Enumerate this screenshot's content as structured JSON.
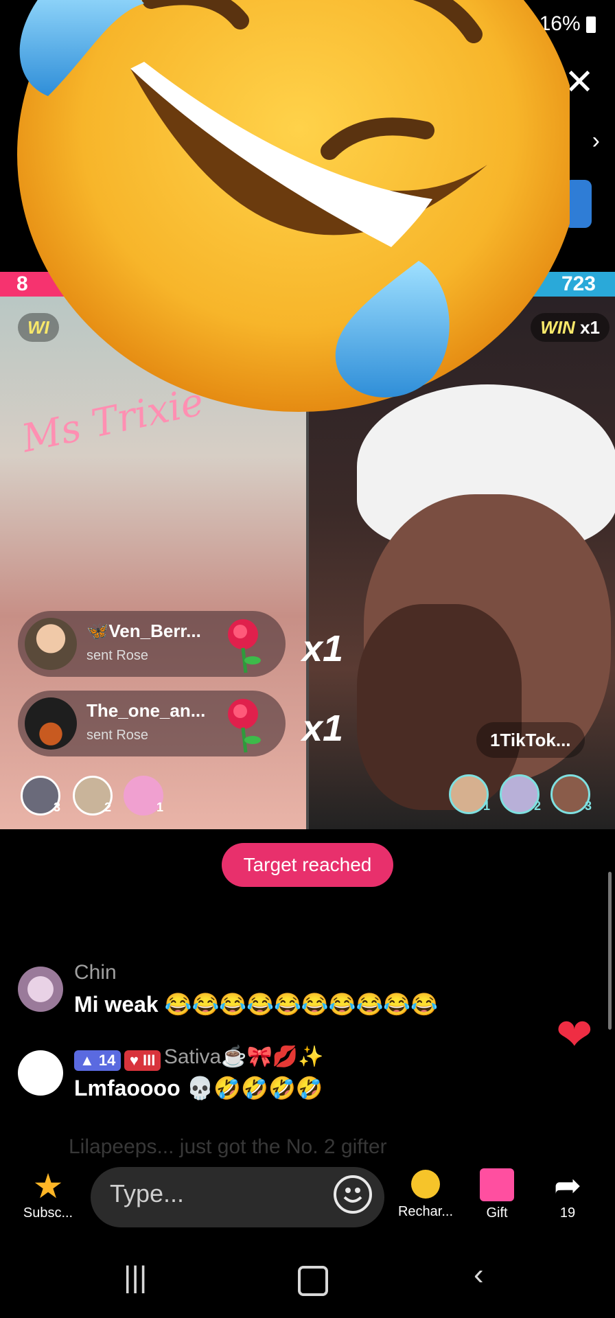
{
  "status": {
    "battery": "16%"
  },
  "battle": {
    "score_left": "8",
    "score_right": "723",
    "win_left": "WI",
    "win_right_word": "WIN",
    "win_right_mult": "x1"
  },
  "left_pane": {
    "neon_sign": "Ms Trixie"
  },
  "gifts": [
    {
      "user": "🦋Ven_Berr...",
      "action": "sent Rose",
      "count": "x1"
    },
    {
      "user": "The_one_an...",
      "action": "sent Rose",
      "count": "x1"
    }
  ],
  "right_pane": {
    "host_tag": "1TikTok..."
  },
  "rank_left": [
    "3",
    "2",
    "1"
  ],
  "rank_right": [
    "1",
    "2",
    "3"
  ],
  "target_label": "Target reached",
  "chat": [
    {
      "name": "Chin",
      "message": "Mi weak 😂😂😂😂😂😂😂😂😂😂"
    },
    {
      "name": "Sativa☕🎀💋✨",
      "badge_level": "14",
      "badge_fan": "III",
      "message": "Lmfaoooo 💀🤣🤣🤣🤣"
    }
  ],
  "chat_faded": "Lilapeeps... just got the No. 2 gifter",
  "input": {
    "placeholder": "Type..."
  },
  "bottom": {
    "subscribe": "Subsc...",
    "recharge": "Rechar...",
    "gift": "Gift",
    "share_count": "19"
  },
  "colors": {
    "accent_pink": "#e8306c",
    "score_blue": "#2aa9d9",
    "score_pink": "#f6336f"
  }
}
